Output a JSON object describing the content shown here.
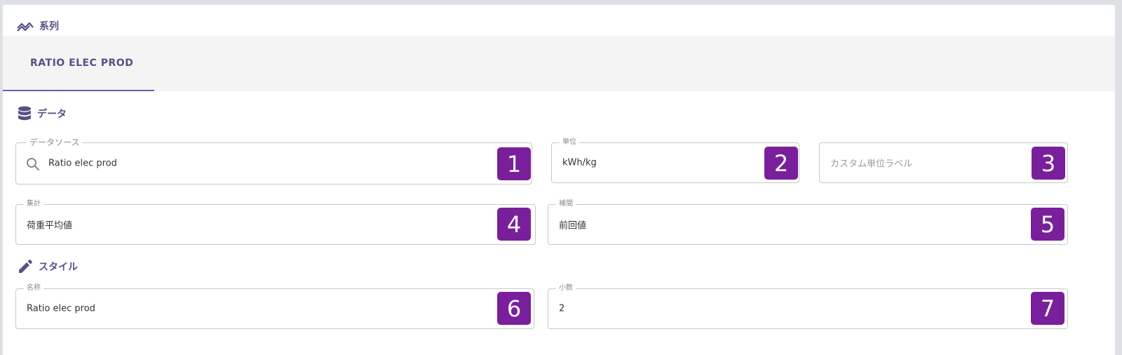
{
  "series_section": {
    "icon": "trend-chart-icon",
    "title": "系列"
  },
  "tabs": [
    {
      "label": "RATIO ELEC PROD",
      "active": true
    }
  ],
  "data_section": {
    "icon": "database-icon",
    "title": "データ"
  },
  "style_section": {
    "icon": "pencil-icon",
    "title": "スタイル"
  },
  "fields": {
    "data_source": {
      "label": "データソース",
      "value": "Ratio elec prod",
      "icon": "search-icon",
      "badge": "1"
    },
    "unit": {
      "label": "単位",
      "value": "kWh/kg",
      "badge": "2"
    },
    "custom_unit": {
      "label": "",
      "placeholder": "カスタム単位ラベル",
      "badge": "3"
    },
    "aggregation": {
      "label": "集計",
      "value": "荷重平均値",
      "badge": "4"
    },
    "interpolation": {
      "label": "補間",
      "value": "前回値",
      "badge": "5"
    },
    "name": {
      "label": "名称",
      "value": "Ratio elec prod",
      "badge": "6"
    },
    "decimals": {
      "label": "小数",
      "value": "2",
      "badge": "7"
    }
  },
  "colors": {
    "accent": "#5b4d86",
    "badge": "#7a1f9c",
    "tab_bg": "#f4f4f5"
  }
}
